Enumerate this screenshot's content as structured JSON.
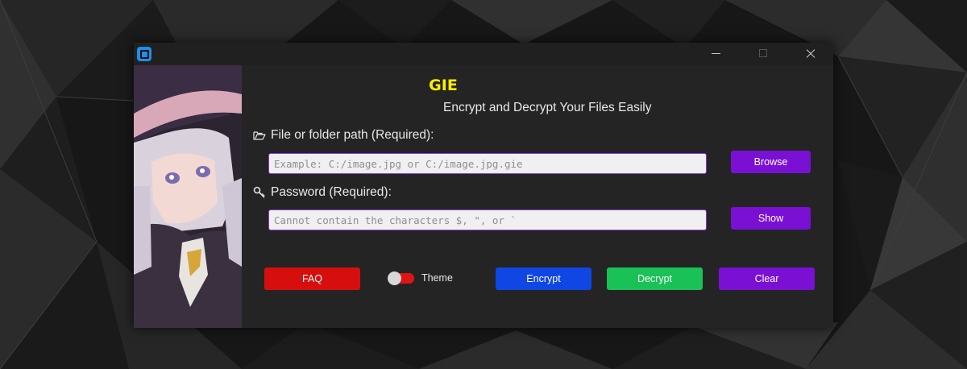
{
  "app": {
    "title": "GIE",
    "subtitle": "Encrypt and Decrypt Your Files Easily"
  },
  "window_controls": {
    "minimize_icon": "minimize-icon",
    "maximize_icon": "maximize-icon",
    "close_icon": "close-icon"
  },
  "path_section": {
    "icon": "open-folder-icon",
    "label": "File or folder path (Required):",
    "value": "",
    "placeholder": "Example: C:/image.jpg or C:/image.jpg.gie",
    "browse_label": "Browse"
  },
  "password_section": {
    "icon": "key-icon",
    "label": "Password (Required):",
    "value": "",
    "placeholder": "Cannot contain the characters $, \", or `",
    "show_label": "Show"
  },
  "bottom_bar": {
    "faq_label": "FAQ",
    "theme_label": "Theme",
    "encrypt_label": "Encrypt",
    "decrypt_label": "Decrypt",
    "clear_label": "Clear"
  },
  "colors": {
    "title": "#ffee00",
    "accent_purple": "#7a10d4",
    "faq_red": "#d60e0e",
    "encrypt_blue": "#0f46e4",
    "decrypt_green": "#19c157",
    "window_bg": "#242424",
    "theme_toggle_track": "#e01414"
  }
}
